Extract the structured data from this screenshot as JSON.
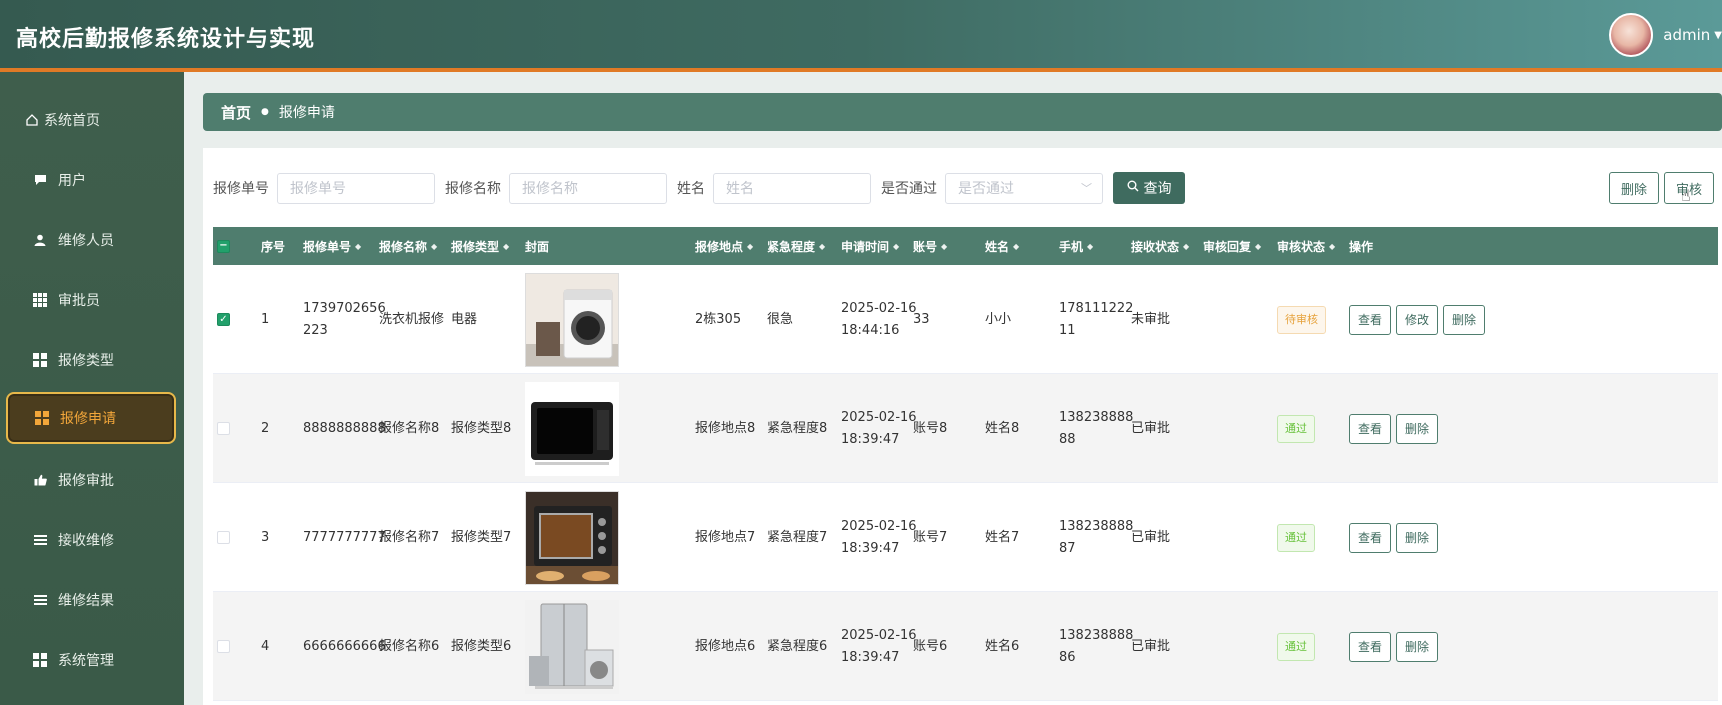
{
  "header": {
    "title": "高校后勤报修系统设计与实现",
    "user": "admin"
  },
  "sidebar": {
    "items": [
      {
        "label": "系统首页",
        "icon": "home-icon"
      },
      {
        "label": "用户",
        "icon": "chat-icon"
      },
      {
        "label": "维修人员",
        "icon": "person-icon"
      },
      {
        "label": "审批员",
        "icon": "grid-icon"
      },
      {
        "label": "报修类型",
        "icon": "apps-icon"
      },
      {
        "label": "报修申请",
        "icon": "apps-icon",
        "active": true
      },
      {
        "label": "报修审批",
        "icon": "thumb-icon"
      },
      {
        "label": "接收维修",
        "icon": "list-icon"
      },
      {
        "label": "维修结果",
        "icon": "list-icon"
      },
      {
        "label": "系统管理",
        "icon": "apps-icon"
      }
    ]
  },
  "breadcrumb": {
    "home": "首页",
    "current": "报修申请"
  },
  "search": {
    "order_no_label": "报修单号",
    "order_no_placeholder": "报修单号",
    "name_label": "报修名称",
    "name_placeholder": "报修名称",
    "person_label": "姓名",
    "person_placeholder": "姓名",
    "passed_label": "是否通过",
    "passed_placeholder": "是否通过",
    "query_label": "查询"
  },
  "actions": {
    "delete_label": "删除",
    "audit_label": "审核"
  },
  "table": {
    "columns": [
      "序号",
      "报修单号",
      "报修名称",
      "报修类型",
      "封面",
      "报修地点",
      "紧急程度",
      "申请时间",
      "账号",
      "姓名",
      "手机",
      "接收状态",
      "审核回复",
      "审核状态",
      "操作"
    ],
    "rows": [
      {
        "index": "1",
        "order_no": "1739702656 223",
        "name": "洗衣机报修",
        "type": "电器",
        "cover": "washing-machine",
        "location": "2栋305",
        "urgency": "很急",
        "date": "2025-02-16",
        "time": "18:44:16",
        "account": "33",
        "person": "小小",
        "phone": "178111222 11",
        "receive_status": "未审批",
        "audit_reply": "",
        "audit_status": "待审核",
        "checked": true,
        "buttons": [
          "查看",
          "修改",
          "删除"
        ]
      },
      {
        "index": "2",
        "order_no": "8888888888",
        "name": "报修名称8",
        "type": "报修类型8",
        "cover": "microwave",
        "location": "报修地点8",
        "urgency": "紧急程度8",
        "date": "2025-02-16",
        "time": "18:39:47",
        "account": "账号8",
        "person": "姓名8",
        "phone": "138238888 88",
        "receive_status": "已审批",
        "audit_reply": "",
        "audit_status": "通过",
        "checked": false,
        "buttons": [
          "查看",
          "删除"
        ]
      },
      {
        "index": "3",
        "order_no": "7777777777",
        "name": "报修名称7",
        "type": "报修类型7",
        "cover": "oven",
        "location": "报修地点7",
        "urgency": "紧急程度7",
        "date": "2025-02-16",
        "time": "18:39:47",
        "account": "账号7",
        "person": "姓名7",
        "phone": "138238888 87",
        "receive_status": "已审批",
        "audit_reply": "",
        "audit_status": "通过",
        "checked": false,
        "buttons": [
          "查看",
          "删除"
        ]
      },
      {
        "index": "4",
        "order_no": "6666666666",
        "name": "报修名称6",
        "type": "报修类型6",
        "cover": "appliances",
        "location": "报修地点6",
        "urgency": "紧急程度6",
        "date": "2025-02-16",
        "time": "18:39:47",
        "account": "账号6",
        "person": "姓名6",
        "phone": "138238888 86",
        "receive_status": "已审批",
        "audit_reply": "",
        "audit_status": "通过",
        "checked": false,
        "buttons": [
          "查看",
          "删除"
        ]
      }
    ]
  },
  "colors": {
    "primary": "#4f7d6e",
    "accent": "#e07a26",
    "active_text": "#f2a63a"
  }
}
